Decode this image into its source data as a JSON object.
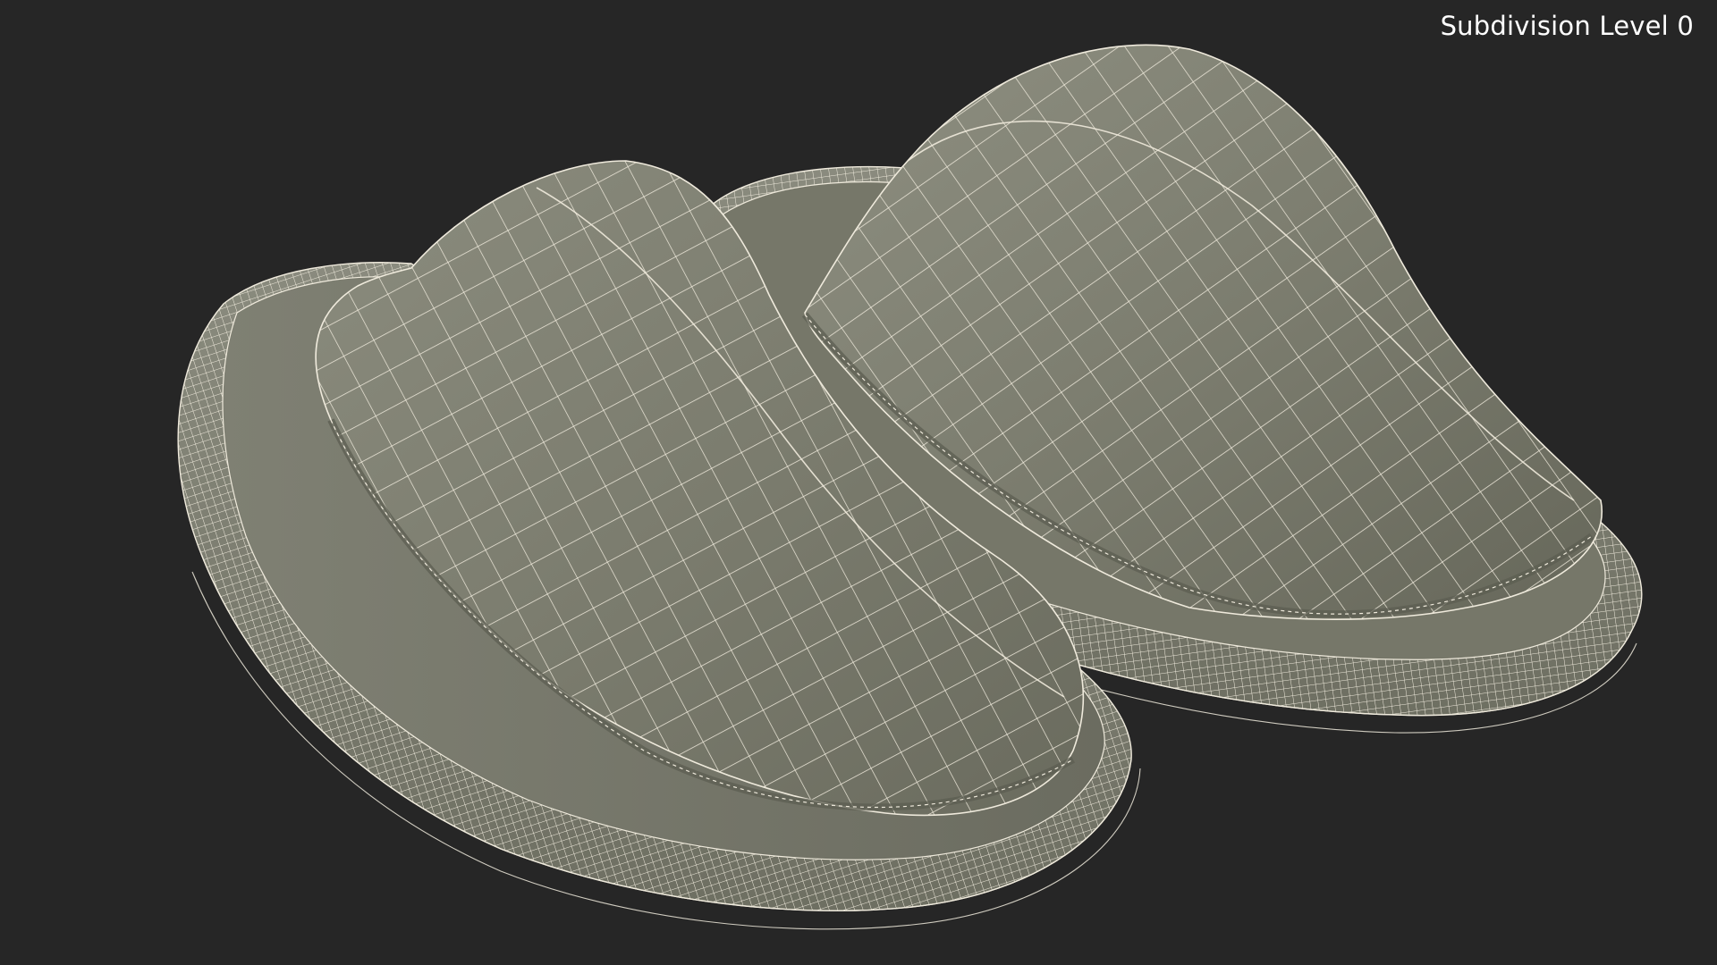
{
  "viewport": {
    "overlay_label": "Subdivision Level 0",
    "background_color": "#262626"
  },
  "model": {
    "object": "slippers",
    "count": 2,
    "display_mode": "wireframe-on-shaded",
    "surface_color": "#7a7b6d",
    "wire_color": "#f2efe2"
  }
}
